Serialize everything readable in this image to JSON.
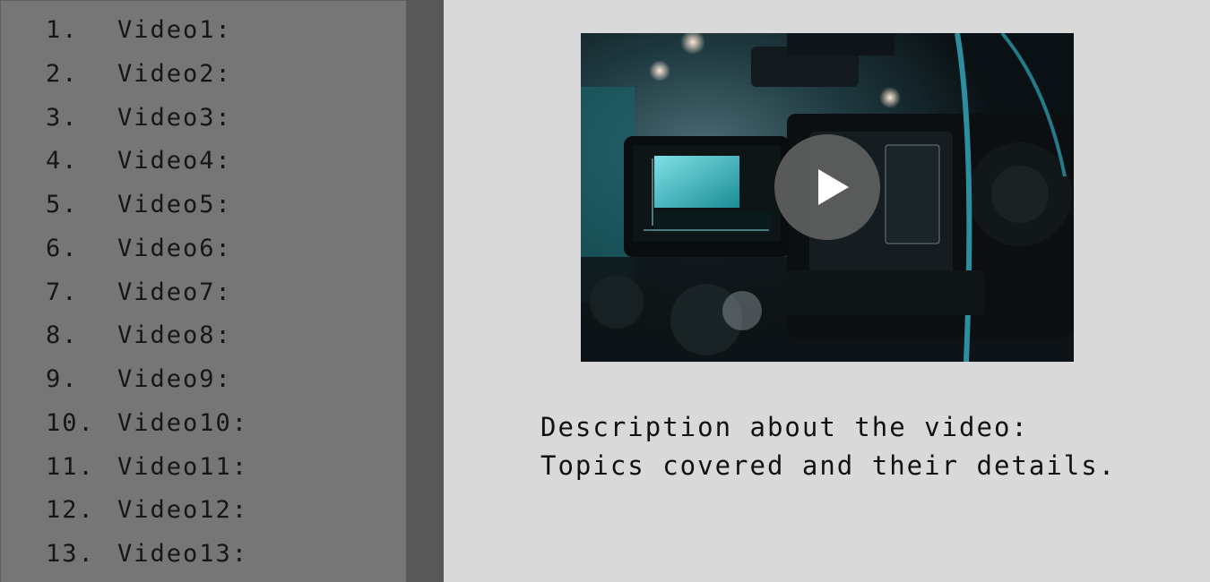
{
  "sidebar": {
    "items": [
      {
        "num": "1.",
        "label": "Video1:"
      },
      {
        "num": "2.",
        "label": "Video2:"
      },
      {
        "num": "3.",
        "label": "Video3:"
      },
      {
        "num": "4.",
        "label": "Video4:"
      },
      {
        "num": "5.",
        "label": "Video5:"
      },
      {
        "num": "6.",
        "label": "Video6:"
      },
      {
        "num": "7.",
        "label": "Video7:"
      },
      {
        "num": "8.",
        "label": "Video8:"
      },
      {
        "num": "9.",
        "label": "Video9:"
      },
      {
        "num": "10.",
        "label": "Video10:"
      },
      {
        "num": "11.",
        "label": "Video11:"
      },
      {
        "num": "12.",
        "label": "Video12:"
      },
      {
        "num": "13.",
        "label": "Video13:"
      }
    ]
  },
  "player": {
    "thumbnail_icon": "video-camera-photo",
    "play_icon": "play-icon"
  },
  "description": {
    "line1": "Description about the video:",
    "line2": "Topics covered and their details."
  },
  "colors": {
    "background": "#d9d9d9",
    "sidebar": "#767676",
    "sidebar_scroll": "#585858",
    "play_button": "#5f5f5f"
  }
}
